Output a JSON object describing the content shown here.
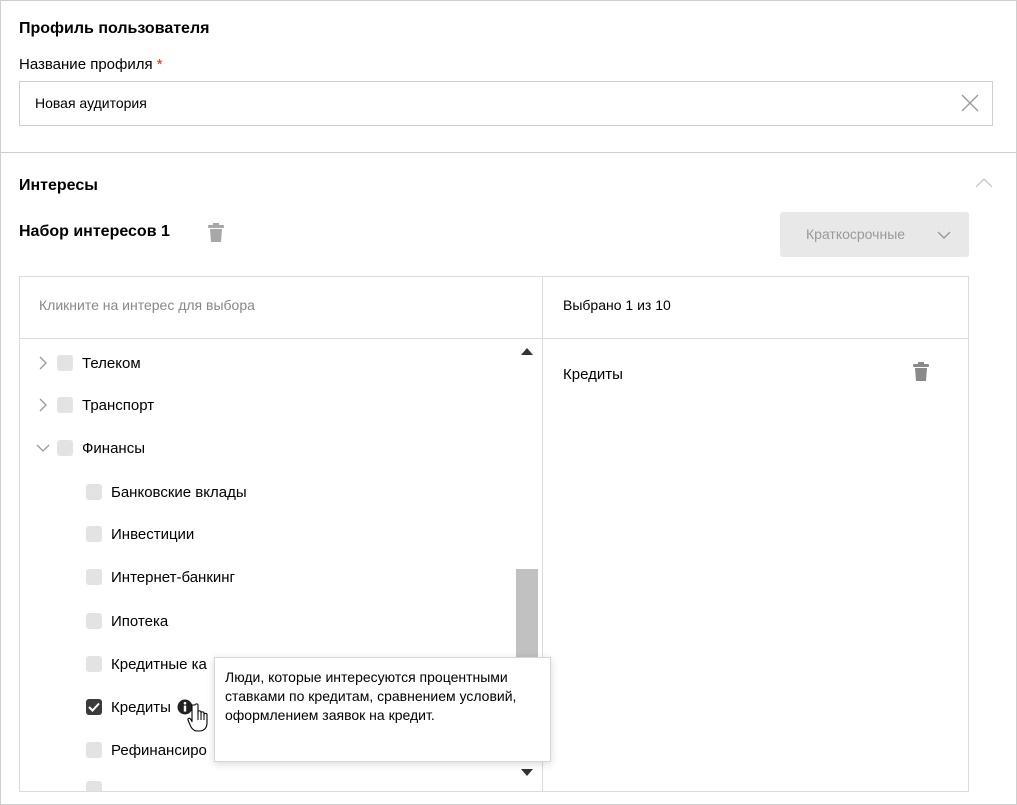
{
  "profile": {
    "section_title": "Профиль пользователя",
    "name_label": "Название профиля",
    "required_mark": "*",
    "name_value": "Новая аудитория"
  },
  "interests": {
    "section_title": "Интересы",
    "set_title": "Набор интересов 1",
    "term_dropdown": "Краткосрочные",
    "hint": "Кликните на интерес для выбора",
    "counter": "Выбрано 1 из 10",
    "tree": [
      {
        "label": "Телеком",
        "level": 0,
        "expanded": false,
        "checked": false
      },
      {
        "label": "Транспорт",
        "level": 0,
        "expanded": false,
        "checked": false
      },
      {
        "label": "Финансы",
        "level": 0,
        "expanded": true,
        "checked": false
      },
      {
        "label": "Банковские вклады",
        "level": 1,
        "checked": false
      },
      {
        "label": "Инвестиции",
        "level": 1,
        "checked": false
      },
      {
        "label": "Интернет-банкинг",
        "level": 1,
        "checked": false
      },
      {
        "label": "Ипотека",
        "level": 1,
        "checked": false
      },
      {
        "label": "Кредитные ка",
        "level": 1,
        "checked": false
      },
      {
        "label": "Кредиты",
        "level": 1,
        "checked": true
      },
      {
        "label": "Рефинансиро",
        "level": 1,
        "checked": false
      }
    ],
    "selected": [
      "Кредиты"
    ],
    "tooltip": "Люди, которые интересуются процентными ставками по кредитам, сравнением условий, оформлением заявок на кредит."
  },
  "colors": {
    "required": "#e8231c",
    "checkbox_checked": "#3a3a3a",
    "checkbox_unchecked": "#e3e3e3",
    "dropdown_bg": "#e8e8e8"
  },
  "icons": [
    "close-icon",
    "chevron-up-icon",
    "trash-icon",
    "chevron-down-icon",
    "chevron-right-icon",
    "check-icon",
    "info-icon",
    "hand-cursor-icon"
  ]
}
